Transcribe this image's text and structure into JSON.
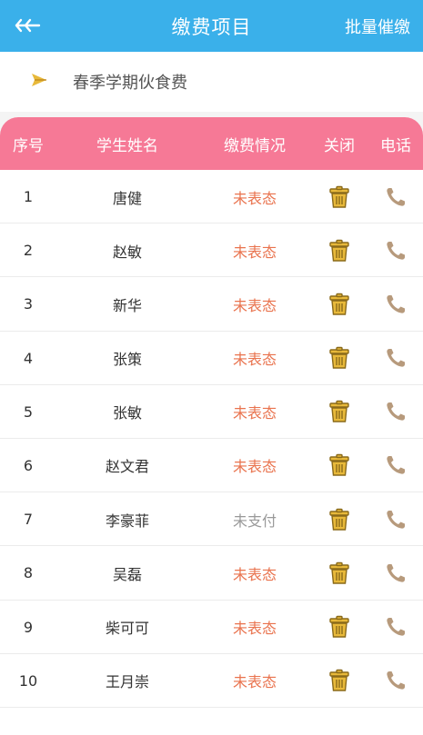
{
  "header": {
    "title": "缴费项目",
    "action": "批量催缴"
  },
  "project": {
    "name": "春季学期伙食费"
  },
  "table": {
    "columns": [
      "序号",
      "学生姓名",
      "缴费情况",
      "关闭",
      "电话"
    ],
    "rows": [
      {
        "no": "1",
        "name": "唐健",
        "status": "未表态",
        "status_type": "red"
      },
      {
        "no": "2",
        "name": "赵敏",
        "status": "未表态",
        "status_type": "red"
      },
      {
        "no": "3",
        "name": "新华",
        "status": "未表态",
        "status_type": "red"
      },
      {
        "no": "4",
        "name": "张策",
        "status": "未表态",
        "status_type": "red"
      },
      {
        "no": "5",
        "name": "张敏",
        "status": "未表态",
        "status_type": "red"
      },
      {
        "no": "6",
        "name": "赵文君",
        "status": "未表态",
        "status_type": "red"
      },
      {
        "no": "7",
        "name": "李豪菲",
        "status": "未支付",
        "status_type": "gray"
      },
      {
        "no": "8",
        "name": "吴磊",
        "status": "未表态",
        "status_type": "red"
      },
      {
        "no": "9",
        "name": "柴可可",
        "status": "未表态",
        "status_type": "red"
      },
      {
        "no": "10",
        "name": "王月崇",
        "status": "未表态",
        "status_type": "red"
      }
    ]
  },
  "colors": {
    "header_bg": "#3ab0ea",
    "table_header_bg": "#f67996",
    "status_red": "#e9734e",
    "status_gray": "#999999",
    "trash_icon": "#e8b93a",
    "phone_icon": "#b79a7c"
  },
  "icons": {
    "back": "double-arrow-left-icon",
    "project": "paper-plane-icon",
    "close": "trash-icon",
    "phone": "phone-icon"
  }
}
